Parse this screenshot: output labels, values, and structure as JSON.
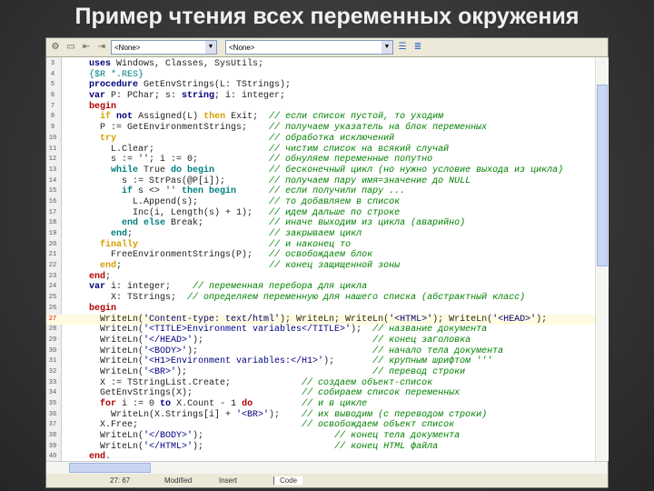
{
  "title": "Пример чтения всех переменных окружения",
  "toolbar": {
    "combo1": "<None>",
    "combo2": "<None>"
  },
  "status": {
    "position": "27: 67",
    "modified": "Modified",
    "mode": "Insert",
    "tab": "Code"
  },
  "current_line": 27,
  "lines": [
    {
      "n": "3",
      "s": [
        [
          "kw",
          "uses"
        ],
        [
          "tx",
          " Windows, Classes, SysUtils;"
        ]
      ]
    },
    {
      "n": "4",
      "s": [
        [
          "dir",
          "{$R *.RES}"
        ]
      ]
    },
    {
      "n": "5",
      "s": [
        [
          "kw",
          "procedure"
        ],
        [
          "tx",
          " GetEnvStrings(L: TStrings);"
        ]
      ]
    },
    {
      "n": "6",
      "s": [
        [
          "kw",
          "var"
        ],
        [
          "tx",
          " P: PChar; s: "
        ],
        [
          "kw",
          "string"
        ],
        [
          "tx",
          "; i: integer;"
        ]
      ]
    },
    {
      "n": "7",
      "s": [
        [
          "kwr",
          "begin"
        ]
      ]
    },
    {
      "n": "8",
      "s": [
        [
          "tx",
          "  "
        ],
        [
          "kwy",
          "if"
        ],
        [
          "tx",
          " "
        ],
        [
          "kw",
          "not"
        ],
        [
          "tx",
          " Assigned(L) "
        ],
        [
          "kwy",
          "then"
        ],
        [
          "tx",
          " Exit;"
        ],
        [
          "cm",
          "// если список пустой, то уходим"
        ]
      ]
    },
    {
      "n": "9",
      "s": [
        [
          "tx",
          "  P := GetEnvironmentStrings;"
        ],
        [
          "cm",
          "// получаем указатель на блок переменных"
        ]
      ]
    },
    {
      "n": "10",
      "s": [
        [
          "tx",
          "  "
        ],
        [
          "kwy",
          "try"
        ],
        [
          "cm",
          "// обработка исключений"
        ]
      ]
    },
    {
      "n": "11",
      "s": [
        [
          "tx",
          "    L.Clear;"
        ],
        [
          "cm",
          "// чистим список на всякий случай"
        ]
      ]
    },
    {
      "n": "12",
      "s": [
        [
          "tx",
          "    s := ''; i := 0;"
        ],
        [
          "cm",
          "// обнуляем переменные попутно"
        ]
      ]
    },
    {
      "n": "13",
      "s": [
        [
          "tx",
          "    "
        ],
        [
          "kwc",
          "while"
        ],
        [
          "tx",
          " True "
        ],
        [
          "kwc",
          "do begin"
        ],
        [
          "cm",
          "// бесконечный цикл (но нужно условие выхода из цикла)"
        ]
      ]
    },
    {
      "n": "14",
      "s": [
        [
          "tx",
          "      s := StrPas(@P[i]);"
        ],
        [
          "cm",
          "// получаем пару имя=значение до NULL"
        ]
      ]
    },
    {
      "n": "15",
      "s": [
        [
          "tx",
          "      "
        ],
        [
          "kwc",
          "if"
        ],
        [
          "tx",
          " s <> '' "
        ],
        [
          "kwc",
          "then begin"
        ],
        [
          "cm",
          "// если получили пару ..."
        ]
      ]
    },
    {
      "n": "16",
      "s": [
        [
          "tx",
          "        L.Append(s);"
        ],
        [
          "cm",
          "// то добавляем в список"
        ]
      ]
    },
    {
      "n": "17",
      "s": [
        [
          "tx",
          "        Inc(i, Length(s) + 1);"
        ],
        [
          "cm",
          "// идем дальше по строке"
        ]
      ]
    },
    {
      "n": "18",
      "s": [
        [
          "tx",
          "      "
        ],
        [
          "kwc",
          "end else"
        ],
        [
          "tx",
          " Break;"
        ],
        [
          "cm",
          "// иначе выходим из цикла (аварийно)"
        ]
      ]
    },
    {
      "n": "19",
      "s": [
        [
          "tx",
          "    "
        ],
        [
          "kwc",
          "end"
        ],
        [
          "tx",
          ";"
        ],
        [
          "cm",
          "// закрываем цикл"
        ]
      ]
    },
    {
      "n": "20",
      "s": [
        [
          "tx",
          "  "
        ],
        [
          "kwy",
          "finally"
        ],
        [
          "cm",
          "// и наконец то"
        ]
      ]
    },
    {
      "n": "21",
      "s": [
        [
          "tx",
          "    FreeEnvironmentStrings(P);"
        ],
        [
          "cm",
          "// освобождаем блок"
        ]
      ]
    },
    {
      "n": "22",
      "s": [
        [
          "tx",
          "  "
        ],
        [
          "kwy",
          "end"
        ],
        [
          "tx",
          ";"
        ],
        [
          "cm",
          "// конец защищенной зоны"
        ]
      ]
    },
    {
      "n": "23",
      "s": [
        [
          "kwr",
          "end"
        ],
        [
          "tx",
          ";"
        ]
      ]
    },
    {
      "n": "24",
      "s": [
        [
          "kw",
          "var"
        ],
        [
          "tx",
          " i: integer;"
        ],
        [
          "cm",
          "// переменная перебора для цикла"
        ]
      ]
    },
    {
      "n": "25",
      "s": [
        [
          "tx",
          "    X: TStrings;"
        ],
        [
          "cm",
          "// определяем переменную для нашего списка (абстрактный класс)"
        ]
      ]
    },
    {
      "n": "26",
      "s": [
        [
          "kwr",
          "begin"
        ]
      ]
    },
    {
      "n": "27",
      "s": [
        [
          "tx",
          "  WriteLn("
        ],
        [
          "str",
          "'Content-type: text/html'"
        ],
        [
          "tx",
          "); WriteLn; WriteLn("
        ],
        [
          "str",
          "'<HTML>'"
        ],
        [
          "tx",
          "); WriteLn("
        ],
        [
          "str",
          "'<HEAD>'"
        ],
        [
          "tx",
          ");"
        ]
      ]
    },
    {
      "n": "28",
      "s": [
        [
          "tx",
          "  WriteLn("
        ],
        [
          "str",
          "'<TITLE>Environment variables</TITLE>'"
        ],
        [
          "tx",
          ");"
        ],
        [
          "cm",
          "// название документа"
        ]
      ]
    },
    {
      "n": "29",
      "s": [
        [
          "tx",
          "  WriteLn("
        ],
        [
          "str",
          "'</HEAD>'"
        ],
        [
          "tx",
          ");"
        ],
        [
          "cm",
          "// конец заголовка"
        ]
      ]
    },
    {
      "n": "30",
      "s": [
        [
          "tx",
          "  WriteLn("
        ],
        [
          "str",
          "'<BODY>'"
        ],
        [
          "tx",
          ");"
        ],
        [
          "cm",
          "// начало тела документа"
        ]
      ]
    },
    {
      "n": "31",
      "s": [
        [
          "tx",
          "  WriteLn("
        ],
        [
          "str",
          "'<H1>Environment variables:</H1>'"
        ],
        [
          "tx",
          ");"
        ],
        [
          "cm",
          "// крупным шрифтом '''"
        ]
      ]
    },
    {
      "n": "32",
      "s": [
        [
          "tx",
          "  WriteLn("
        ],
        [
          "str",
          "'<BR>'"
        ],
        [
          "tx",
          ");"
        ],
        [
          "cm",
          "// перевод строки"
        ]
      ]
    },
    {
      "n": "33",
      "s": [
        [
          "tx",
          "  X := TStringList.Create;"
        ],
        [
          "cm",
          "// создаем объект-список"
        ]
      ]
    },
    {
      "n": "34",
      "s": [
        [
          "tx",
          "  GetEnvStrings(X);"
        ],
        [
          "cm",
          "// собираем список переменных"
        ]
      ]
    },
    {
      "n": "35",
      "s": [
        [
          "tx",
          "  "
        ],
        [
          "kwr",
          "for"
        ],
        [
          "tx",
          " i := 0 "
        ],
        [
          "kw",
          "to"
        ],
        [
          "tx",
          " X.Count - 1 "
        ],
        [
          "kwr",
          "do"
        ],
        [
          "cm",
          "// и в цикле"
        ]
      ]
    },
    {
      "n": "36",
      "s": [
        [
          "tx",
          "    WriteLn(X.Strings[i] + "
        ],
        [
          "str",
          "'<BR>'"
        ],
        [
          "tx",
          ");"
        ],
        [
          "cm",
          "// их выводим (с переводом строки)"
        ]
      ]
    },
    {
      "n": "37",
      "s": [
        [
          "tx",
          "  X.Free;"
        ],
        [
          "cm",
          "// освобождаем объект список"
        ]
      ]
    },
    {
      "n": "38",
      "s": [
        [
          "tx",
          "  WriteLn("
        ],
        [
          "str",
          "'</BODY>'"
        ],
        [
          "tx",
          ");"
        ],
        [
          "cm",
          "// конец тела документа"
        ]
      ]
    },
    {
      "n": "39",
      "s": [
        [
          "tx",
          "  WriteLn("
        ],
        [
          "str",
          "'</HTML>'"
        ],
        [
          "tx",
          ");"
        ],
        [
          "cm",
          "// конец HTML файла"
        ]
      ]
    },
    {
      "n": "40",
      "s": [
        [
          "kwr",
          "end"
        ],
        [
          "tx",
          "."
        ]
      ]
    }
  ]
}
